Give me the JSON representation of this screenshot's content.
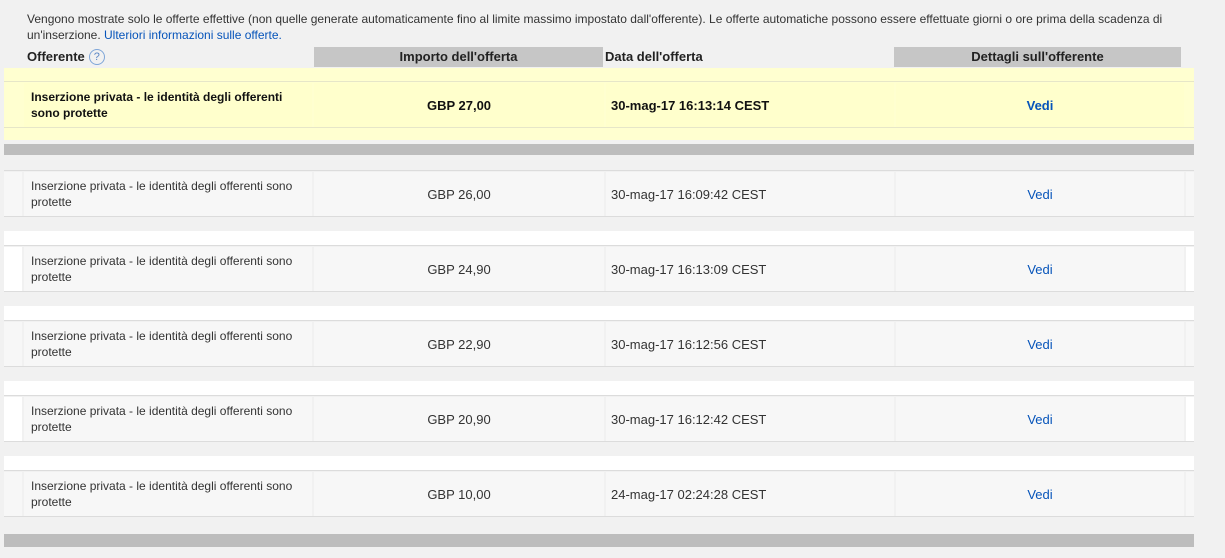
{
  "intro": {
    "text": "Vengono mostrate solo le offerte effettive (non quelle generate automaticamente fino al limite massimo impostato dall'offerente). Le offerte automatiche possono essere effettuate giorni o ore prima della scadenza di un'inserzione.",
    "link": "Ulteriori informazioni sulle offerte."
  },
  "header": {
    "bidder": "Offerente",
    "help": "?",
    "amount": "Importo dell'offerta",
    "date": "Data dell'offerta",
    "details": "Dettagli sull'offerente"
  },
  "winning": {
    "bidder": "Inserzione privata - le identità degli offerenti sono protette",
    "amount": "GBP 27,00",
    "date": "30-mag-17 16:13:14 CEST",
    "link": "Vedi"
  },
  "bids": [
    {
      "bidder": "Inserzione privata - le identità degli offerenti sono protette",
      "amount": "GBP 26,00",
      "date": "30-mag-17 16:09:42 CEST",
      "link": "Vedi"
    },
    {
      "bidder": "Inserzione privata - le identità degli offerenti sono protette",
      "amount": "GBP 24,90",
      "date": "30-mag-17 16:13:09 CEST",
      "link": "Vedi"
    },
    {
      "bidder": "Inserzione privata - le identità degli offerenti sono protette",
      "amount": "GBP 22,90",
      "date": "30-mag-17 16:12:56 CEST",
      "link": "Vedi"
    },
    {
      "bidder": "Inserzione privata - le identità degli offerenti sono protette",
      "amount": "GBP 20,90",
      "date": "30-mag-17 16:12:42 CEST",
      "link": "Vedi"
    },
    {
      "bidder": "Inserzione privata - le identità degli offerenti sono protette",
      "amount": "GBP 10,00",
      "date": "24-mag-17 02:24:28 CEST",
      "link": "Vedi"
    }
  ]
}
